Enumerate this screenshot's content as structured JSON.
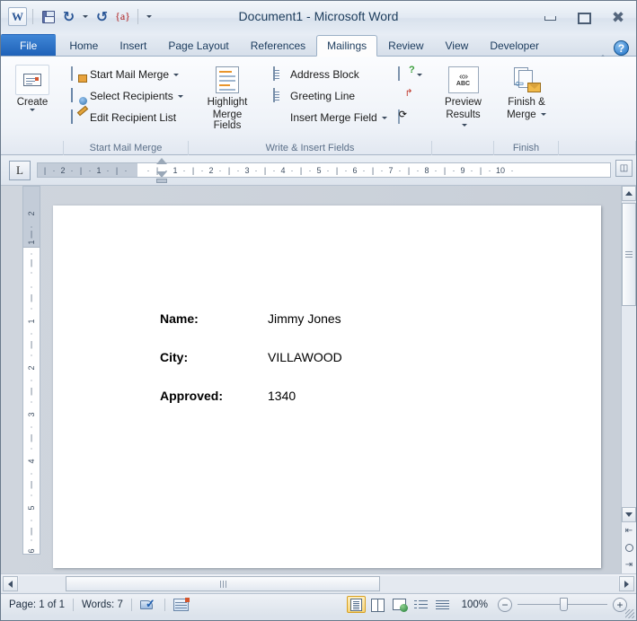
{
  "window": {
    "title": "Document1  -  Microsoft Word",
    "minimize_label": "Minimize",
    "maximize_label": "Restore",
    "close_label": "Close"
  },
  "quick_access": {
    "app_logo": "W",
    "items": [
      {
        "name": "save-button",
        "icon": "save-icon",
        "label": "Save"
      },
      {
        "name": "undo-button",
        "icon": "undo-icon",
        "label": "Undo"
      },
      {
        "name": "redo-button",
        "icon": "redo-icon",
        "label": "Redo"
      },
      {
        "name": "toggle-field-codes-button",
        "icon": "field-codes-icon",
        "label": "{a}"
      },
      {
        "name": "customize-qat-button",
        "icon": "chevron-down-icon",
        "label": "Customize Quick Access Toolbar"
      }
    ],
    "field_codes_glyph": "{a}"
  },
  "tabs": {
    "items": [
      {
        "label": "File",
        "active": false,
        "style": "file"
      },
      {
        "label": "Home",
        "active": false
      },
      {
        "label": "Insert",
        "active": false
      },
      {
        "label": "Page Layout",
        "active": false
      },
      {
        "label": "References",
        "active": false
      },
      {
        "label": "Mailings",
        "active": true
      },
      {
        "label": "Review",
        "active": false
      },
      {
        "label": "View",
        "active": false
      },
      {
        "label": "Developer",
        "active": false
      }
    ],
    "minimize_ribbon_label": "Minimize the Ribbon",
    "help_label": "?"
  },
  "ribbon": {
    "groups": [
      {
        "title": "Create",
        "is_title_shown": false,
        "big_buttons": [
          {
            "label": "Create",
            "icon": "envelope-icon",
            "has_dropdown": true
          }
        ]
      },
      {
        "title": "Start Mail Merge",
        "small_buttons": [
          {
            "label": "Start Mail Merge",
            "icon": "start-mail-merge-icon",
            "has_dropdown": true
          },
          {
            "label": "Select Recipients",
            "icon": "select-recipients-icon",
            "has_dropdown": true
          },
          {
            "label": "Edit Recipient List",
            "icon": "edit-recipient-list-icon",
            "has_dropdown": false
          }
        ]
      },
      {
        "title": "Write & Insert Fields",
        "big_buttons": [
          {
            "label": "Highlight\nMerge Fields",
            "label_line1": "Highlight",
            "label_line2": "Merge Fields",
            "icon": "highlight-merge-fields-icon",
            "has_dropdown": false
          }
        ],
        "small_buttons": [
          {
            "label": "Address Block",
            "icon": "address-block-icon",
            "has_dropdown": false
          },
          {
            "label": "Greeting Line",
            "icon": "greeting-line-icon",
            "has_dropdown": false
          },
          {
            "label": "Insert Merge Field",
            "icon": "insert-merge-field-icon",
            "has_dropdown": true
          }
        ],
        "icon_only_buttons": [
          {
            "name": "rules-button",
            "icon": "rules-icon",
            "has_dropdown": true
          },
          {
            "name": "match-fields-button",
            "icon": "match-fields-icon",
            "has_dropdown": false
          },
          {
            "name": "update-labels-button",
            "icon": "update-labels-icon",
            "has_dropdown": false
          }
        ]
      },
      {
        "title": "",
        "big_buttons": [
          {
            "label_line1": "Preview",
            "label_line2": "Results",
            "icon": "preview-results-icon",
            "has_dropdown": true
          }
        ]
      },
      {
        "title": "Finish",
        "big_buttons": [
          {
            "label_line1": "Finish &",
            "label_line2": "Merge",
            "icon": "finish-and-merge-icon",
            "has_dropdown": true
          }
        ]
      }
    ]
  },
  "ruler": {
    "tab_stop_selector": "L",
    "horizontal_left_labels": [
      "2",
      "1"
    ],
    "horizontal_right_labels": [
      "1",
      "2",
      "3",
      "4",
      "5",
      "6",
      "7",
      "8",
      "9",
      "10"
    ],
    "vertical_margin_labels": [
      "2",
      "1"
    ],
    "vertical_labels": [
      "1",
      "2",
      "3",
      "4",
      "5",
      "6"
    ],
    "view_ruler_button": "view-ruler-icon"
  },
  "document": {
    "lines": [
      {
        "label": "Name:",
        "value": "Jimmy Jones"
      },
      {
        "label": "City:",
        "value": "VILLAWOOD"
      },
      {
        "label": "Approved:",
        "value": "1340"
      }
    ]
  },
  "scrollbars": {
    "vertical": {
      "scroll_up": "scroll-up-arrow",
      "scroll_down": "scroll-down-arrow",
      "previous_page": "previous-page-icon",
      "select_browse_object": "select-browse-object-icon",
      "next_page": "next-page-icon"
    },
    "horizontal": {
      "scroll_left": "scroll-left-arrow",
      "scroll_right": "scroll-right-arrow"
    }
  },
  "status_bar": {
    "page_text": "Page: 1 of 1",
    "words_text": "Words: 7",
    "spelling_icon": "spelling-and-grammar-icon",
    "language_icon": "language-icon",
    "views": [
      {
        "label": "Print Layout",
        "icon": "print-layout-icon",
        "active": true
      },
      {
        "label": "Full Screen Reading",
        "icon": "full-screen-reading-icon",
        "active": false
      },
      {
        "label": "Web Layout",
        "icon": "web-layout-icon",
        "active": false
      },
      {
        "label": "Outline",
        "icon": "outline-icon",
        "active": false
      },
      {
        "label": "Draft",
        "icon": "draft-icon",
        "active": false
      }
    ],
    "zoom_level": "100%",
    "zoom_out_label": "−",
    "zoom_in_label": "+"
  }
}
